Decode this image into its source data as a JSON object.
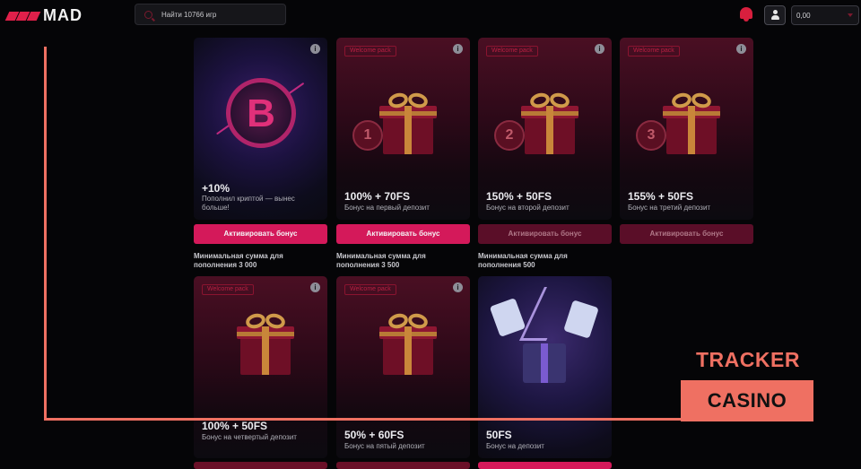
{
  "header": {
    "logo_text": "MAD",
    "search_placeholder": "Найти 10766 игр",
    "balance": "0,00"
  },
  "cards": [
    {
      "badge": "",
      "title": "+10%",
      "desc": "Пополнил криптой — вынес больше!",
      "button": "Активировать бонус",
      "min": "Минимальная сумма для пополнения 3 000"
    },
    {
      "badge": "Welcome pack",
      "title": "100% + 70FS",
      "desc": "Бонус на первый депозит",
      "button": "Активировать бонус",
      "min": "Минимальная сумма для пополнения 3 500",
      "coin": "1"
    },
    {
      "badge": "Welcome pack",
      "title": "150% + 50FS",
      "desc": "Бонус на второй депозит",
      "button": "Активировать бонус",
      "min": "Минимальная сумма для пополнения 500",
      "coin": "2"
    },
    {
      "badge": "Welcome pack",
      "title": "155% + 50FS",
      "desc": "Бонус на третий депозит",
      "button": "Активировать бонус",
      "coin": "3"
    },
    {
      "badge": "Welcome pack",
      "title": "100% + 50FS",
      "desc": "Бонус на четвертый депозит"
    },
    {
      "badge": "Welcome pack",
      "title": "50% + 60FS",
      "desc": "Бонус на пятый депозит"
    },
    {
      "badge": "",
      "title": "50FS",
      "desc": "Бонус на депозит"
    }
  ],
  "overlay": {
    "tracker": "TRACKER",
    "casino": "CASINO"
  },
  "colors": {
    "accent": "#d4195a",
    "overlay": "#ef7062"
  },
  "icons": {
    "info": "i"
  }
}
